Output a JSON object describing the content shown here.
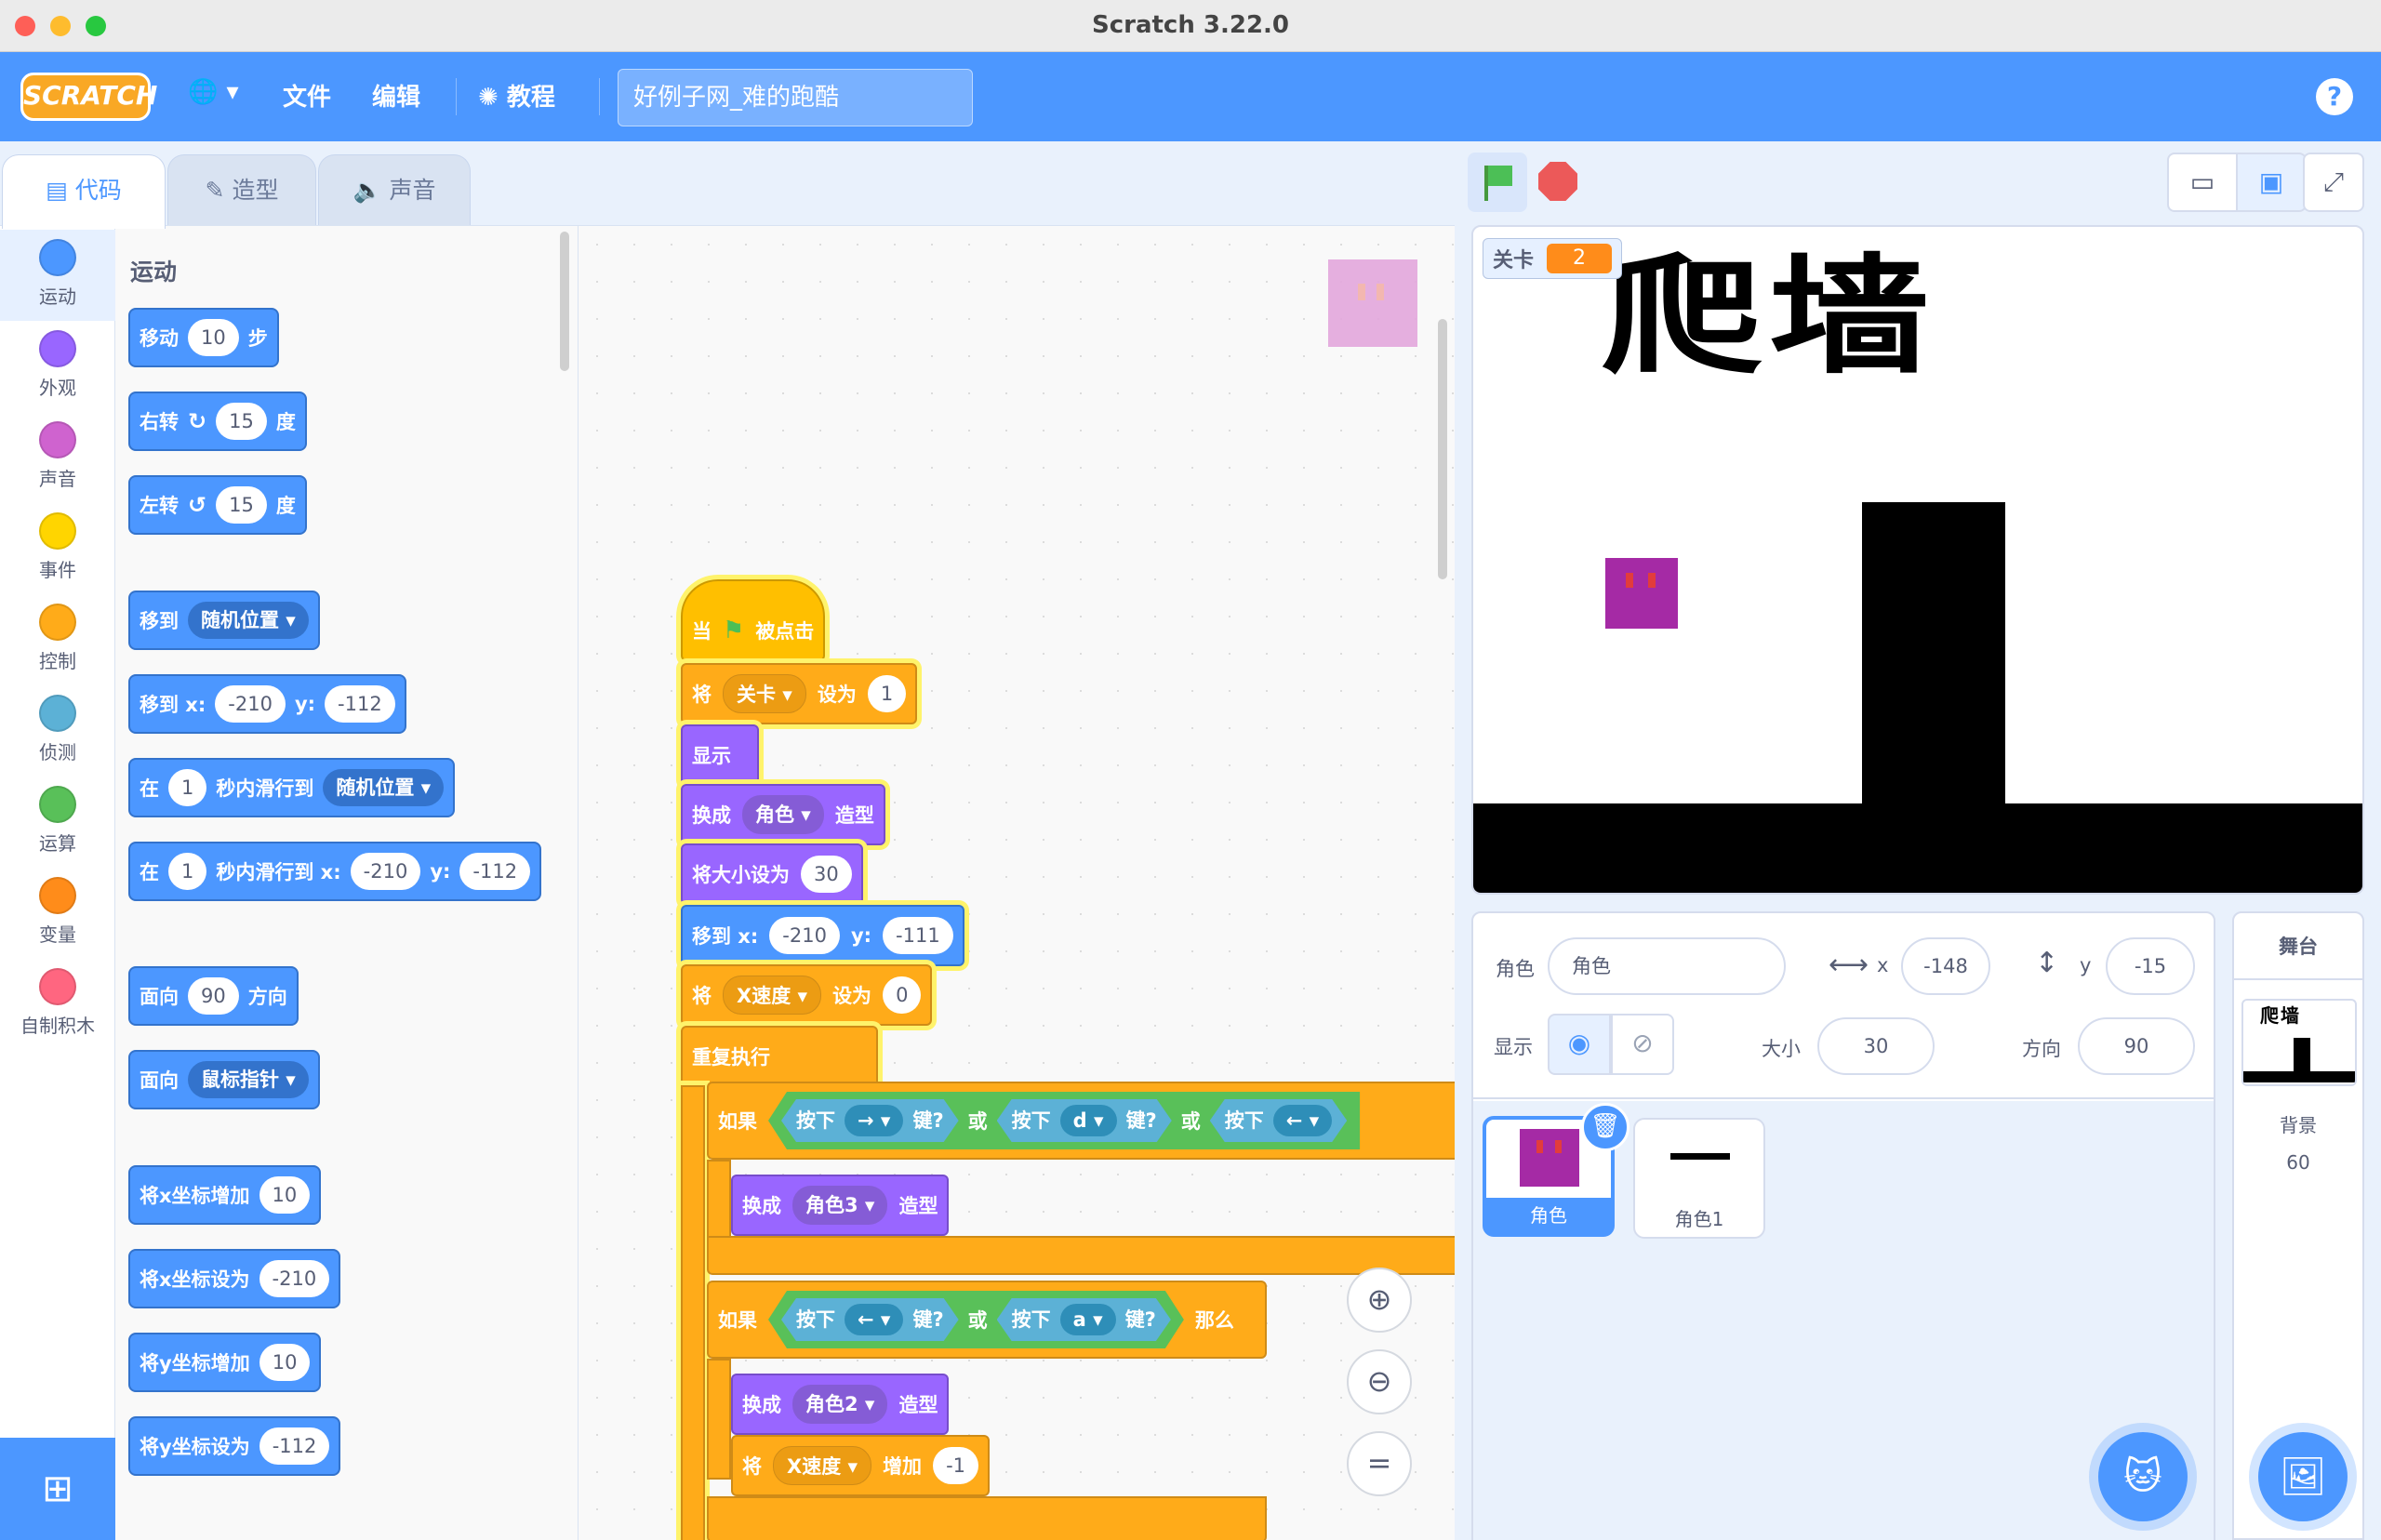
{
  "window": {
    "title": "Scratch 3.22.0"
  },
  "menubar": {
    "logo": "SCRATCH",
    "language_icon": "globe-icon",
    "file": "文件",
    "edit": "编辑",
    "tutorials": "教程",
    "project_title": "好例子网_难的跑酷",
    "help": "?"
  },
  "tabs": {
    "code": "代码",
    "costumes": "造型",
    "sounds": "声音"
  },
  "categories": [
    {
      "label": "运动",
      "color": "#4c97ff"
    },
    {
      "label": "外观",
      "color": "#9966ff"
    },
    {
      "label": "声音",
      "color": "#cf63cf"
    },
    {
      "label": "事件",
      "color": "#ffd500"
    },
    {
      "label": "控制",
      "color": "#ffab19"
    },
    {
      "label": "侦测",
      "color": "#5cb1d6"
    },
    {
      "label": "运算",
      "color": "#59c059"
    },
    {
      "label": "变量",
      "color": "#ff8c1a"
    },
    {
      "label": "自制积木",
      "color": "#ff6680"
    }
  ],
  "palette": {
    "heading": "运动",
    "move": {
      "a": "移动",
      "v": "10",
      "b": "步"
    },
    "turn_right": {
      "a": "右转",
      "v": "15",
      "b": "度"
    },
    "turn_left": {
      "a": "左转",
      "v": "15",
      "b": "度"
    },
    "goto": {
      "a": "移到",
      "dd": "随机位置"
    },
    "goto_xy": {
      "a": "移到 x:",
      "x": "-210",
      "b": "y:",
      "y": "-112"
    },
    "glide": {
      "a": "在",
      "v": "1",
      "b": "秒内滑行到",
      "dd": "随机位置"
    },
    "glide_xy": {
      "a": "在",
      "v": "1",
      "b": "秒内滑行到 x:",
      "x": "-210",
      "c": "y:",
      "y": "-112"
    },
    "point_dir": {
      "a": "面向",
      "v": "90",
      "b": "方向"
    },
    "point_towards": {
      "a": "面向",
      "dd": "鼠标指针"
    },
    "change_x": {
      "a": "将x坐标增加",
      "v": "10"
    },
    "set_x": {
      "a": "将x坐标设为",
      "v": "-210"
    },
    "change_y": {
      "a": "将y坐标增加",
      "v": "10"
    },
    "set_y": {
      "a": "将y坐标设为",
      "v": "-112"
    }
  },
  "script": {
    "hat": {
      "a": "当",
      "b": "被点击"
    },
    "set_level": {
      "a": "将",
      "dd": "关卡",
      "b": "设为",
      "v": "1"
    },
    "show": "显示",
    "switch_costume": {
      "a": "换成",
      "dd": "角色",
      "b": "造型"
    },
    "set_size": {
      "a": "将大小设为",
      "v": "30"
    },
    "goto_xy": {
      "a": "移到 x:",
      "x": "-210",
      "b": "y:",
      "y": "-111"
    },
    "set_xspeed": {
      "a": "将",
      "dd": "X速度",
      "b": "设为",
      "v": "0"
    },
    "forever": "重复执行",
    "if1": {
      "a": "如果",
      "k1": "按下",
      "d1": "→",
      "k1b": "键?",
      "or1": "或",
      "k2": "按下",
      "d2": "d",
      "k2b": "键?",
      "or2": "或",
      "k3": "按下",
      "d3": "←"
    },
    "if1_body": {
      "a": "换成",
      "dd": "角色3",
      "b": "造型"
    },
    "if2": {
      "a": "如果",
      "k1": "按下",
      "d1": "←",
      "k1b": "键?",
      "or1": "或",
      "k2": "按下",
      "d2": "a",
      "k2b": "键?",
      "then": "那么"
    },
    "if2_body1": {
      "a": "换成",
      "dd": "角色2",
      "b": "造型"
    },
    "if2_body2": {
      "a": "将",
      "dd": "X速度",
      "b": "增加",
      "v": "-1"
    }
  },
  "stage": {
    "monitor_label": "关卡",
    "monitor_value": "2",
    "title_text": "爬墙"
  },
  "sprite_info": {
    "sprite_label": "角色",
    "sprite_name": "角色",
    "x_label": "x",
    "x": "-148",
    "y_label": "y",
    "y": "-15",
    "show_label": "显示",
    "size_label": "大小",
    "size": "30",
    "direction_label": "方向",
    "direction": "90"
  },
  "sprites": [
    {
      "name": "角色"
    },
    {
      "name": "角色1"
    }
  ],
  "stage_panel": {
    "header": "舞台",
    "backdrop_label": "背景",
    "backdrop_count": "60"
  }
}
